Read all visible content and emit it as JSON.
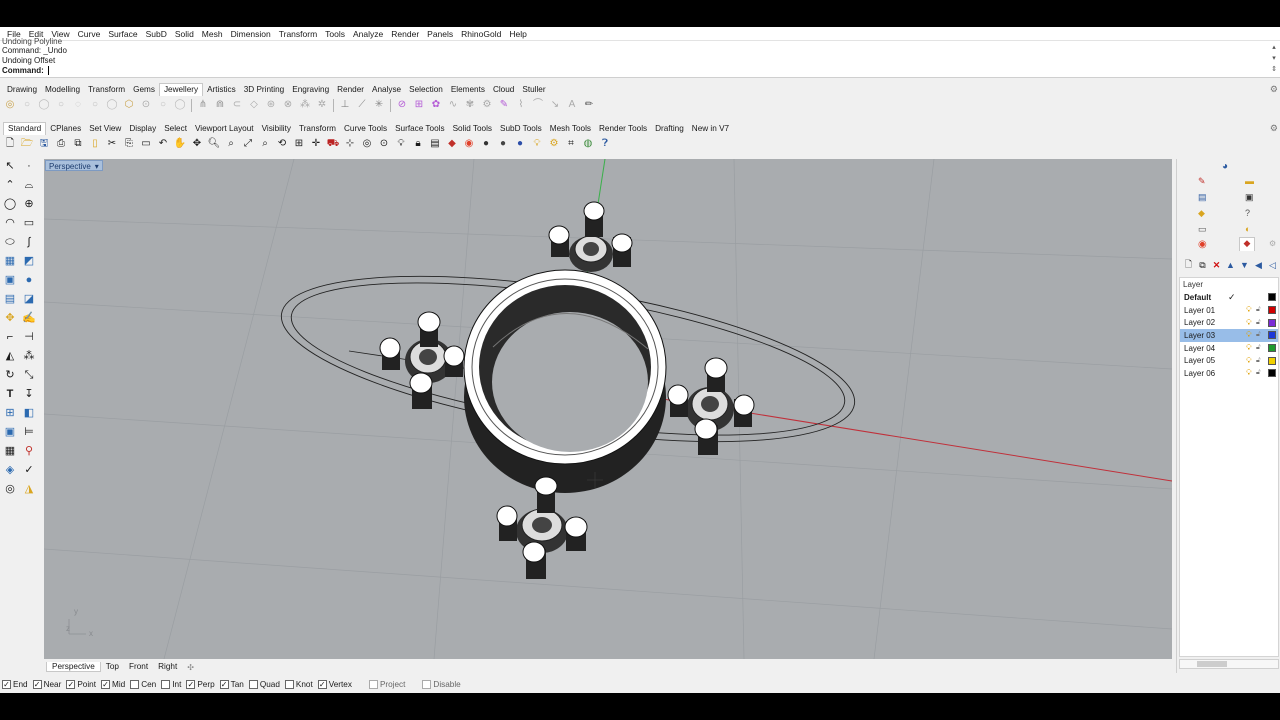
{
  "menu": [
    "File",
    "Edit",
    "View",
    "Curve",
    "Surface",
    "SubD",
    "Solid",
    "Mesh",
    "Dimension",
    "Transform",
    "Tools",
    "Analyze",
    "Render",
    "Panels",
    "RhinoGold",
    "Help"
  ],
  "command": {
    "history": [
      "Undoing Polyline",
      "Command: _Undo",
      "Undoing Offset"
    ],
    "prompt": "Command:"
  },
  "rhinogold_tabs": [
    "Drawing",
    "Modelling",
    "Transform",
    "Gems",
    "Jewellery",
    "Artistics",
    "3D Printing",
    "Engraving",
    "Render",
    "Analyse",
    "Selection",
    "Elements",
    "Cloud",
    "Stuller"
  ],
  "rhinogold_active": "Jewellery",
  "rhino_tabs": [
    "Standard",
    "CPlanes",
    "Set View",
    "Display",
    "Select",
    "Viewport Layout",
    "Visibility",
    "Transform",
    "Curve Tools",
    "Surface Tools",
    "Solid Tools",
    "SubD Tools",
    "Mesh Tools",
    "Render Tools",
    "Drafting",
    "New in V7"
  ],
  "rhino_active": "Standard",
  "viewport": {
    "title": "Perspective",
    "dropdown_glyph": "▾",
    "axis_y": "y",
    "axis_z": "z",
    "axis_x": "x",
    "background": "#a9acaf"
  },
  "viewport_tabs": [
    "Perspective",
    "Top",
    "Front",
    "Right"
  ],
  "viewport_tab_add": "✣",
  "snaps": [
    {
      "label": "End",
      "checked": true
    },
    {
      "label": "Near",
      "checked": true
    },
    {
      "label": "Point",
      "checked": true
    },
    {
      "label": "Mid",
      "checked": true
    },
    {
      "label": "Cen",
      "checked": false
    },
    {
      "label": "Int",
      "checked": false
    },
    {
      "label": "Perp",
      "checked": true
    },
    {
      "label": "Tan",
      "checked": true
    },
    {
      "label": "Quad",
      "checked": false
    },
    {
      "label": "Knot",
      "checked": false
    },
    {
      "label": "Vertex",
      "checked": true
    },
    {
      "label": "Project",
      "checked": false,
      "disabled": true
    },
    {
      "label": "Disable",
      "checked": false,
      "disabled": true
    }
  ],
  "layers": {
    "header": "Layer",
    "rows": [
      {
        "name": "Default",
        "current": true,
        "color": "#000000",
        "check": "✓"
      },
      {
        "name": "Layer 01",
        "color": "#d00000"
      },
      {
        "name": "Layer 02",
        "color": "#7a2bd6"
      },
      {
        "name": "Layer 03",
        "color": "#1c38d8",
        "selected": true
      },
      {
        "name": "Layer 04",
        "color": "#1f9a2c"
      },
      {
        "name": "Layer 05",
        "color": "#f0d000"
      },
      {
        "name": "Layer 06",
        "color": "#000000"
      }
    ]
  },
  "colors": {
    "accent_selection": "#98bde8",
    "axis_x": "#c0303a",
    "axis_y": "#2ea83a"
  }
}
